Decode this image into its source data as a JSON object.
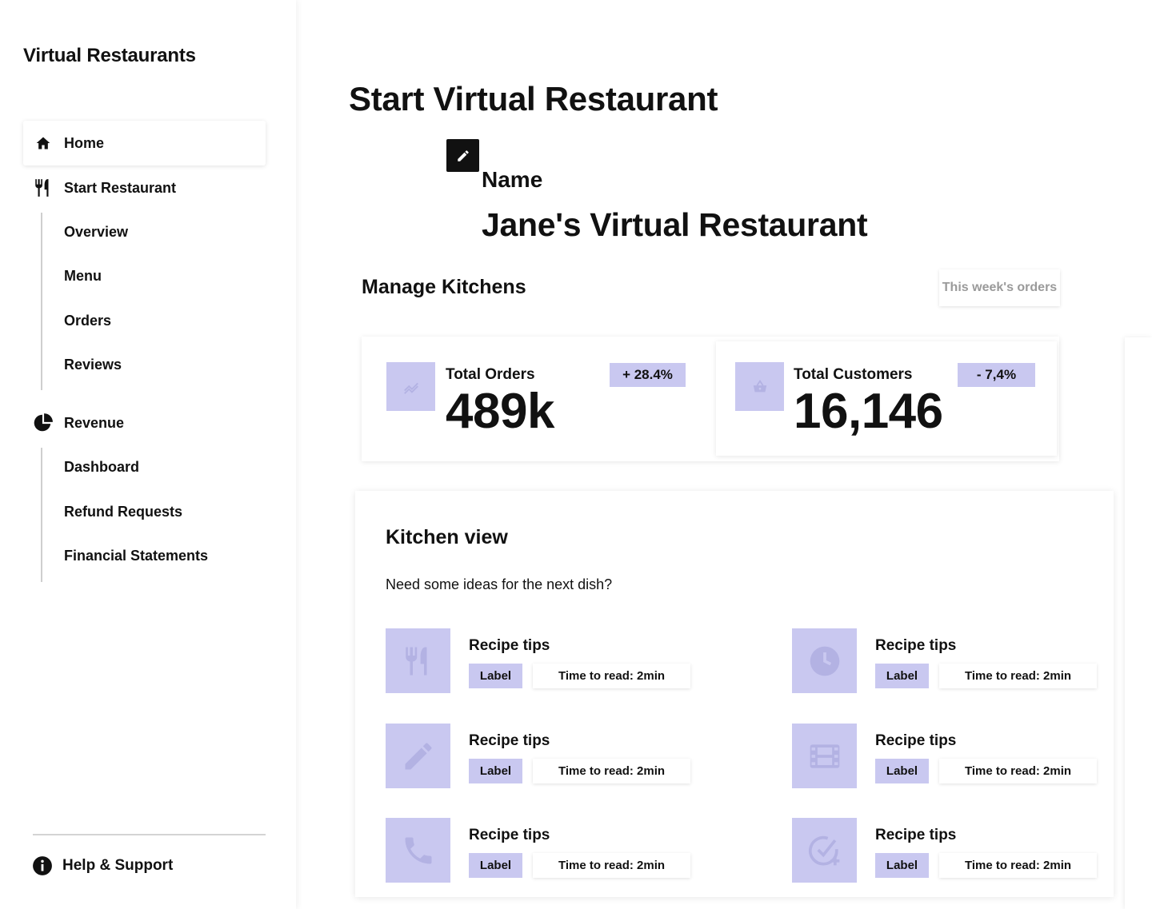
{
  "sidebar": {
    "brand": "Virtual Restaurants",
    "home": {
      "label": "Home",
      "icon": "home-icon"
    },
    "start_restaurant": {
      "label": "Start Restaurant",
      "icon": "utensils-icon",
      "items": [
        "Overview",
        "Menu",
        "Orders",
        "Reviews"
      ]
    },
    "revenue": {
      "label": "Revenue",
      "icon": "pie-chart-icon",
      "items": [
        "Dashboard",
        "Refund Requests",
        "Financial Statements"
      ]
    },
    "help": {
      "label": "Help & Support",
      "icon": "info-icon"
    }
  },
  "main": {
    "title": "Start Virtual Restaurant",
    "name_label": "Name",
    "name_value": "Jane's Virtual Restaurant",
    "section_title": "Manage Kitchens",
    "week_button": "This week's orders",
    "stats": [
      {
        "label": "Total Orders",
        "value": "489k",
        "badge": "+ 28.4%",
        "icon": "trend-icon"
      },
      {
        "label": "Total Customers",
        "value": "16,146",
        "badge": "- 7,4%",
        "icon": "basket-icon"
      }
    ],
    "kitchen": {
      "title": "Kitchen view",
      "subtitle": "Need some ideas for the next dish?",
      "tips": [
        {
          "title": "Recipe tips",
          "label": "Label",
          "time": "Time to read: 2min",
          "icon": "utensils-icon"
        },
        {
          "title": "Recipe tips",
          "label": "Label",
          "time": "Time to read: 2min",
          "icon": "clock-icon"
        },
        {
          "title": "Recipe tips",
          "label": "Label",
          "time": "Time to read: 2min",
          "icon": "pencil-icon"
        },
        {
          "title": "Recipe tips",
          "label": "Label",
          "time": "Time to read: 2min",
          "icon": "film-icon"
        },
        {
          "title": "Recipe tips",
          "label": "Label",
          "time": "Time to read: 2min",
          "icon": "phone-icon"
        },
        {
          "title": "Recipe tips",
          "label": "Label",
          "time": "Time to read: 2min",
          "icon": "check-add-icon"
        }
      ]
    }
  },
  "colors": {
    "accent": "#c9c8f0",
    "icon_muted": "#b3b2e3",
    "text": "#111111"
  }
}
